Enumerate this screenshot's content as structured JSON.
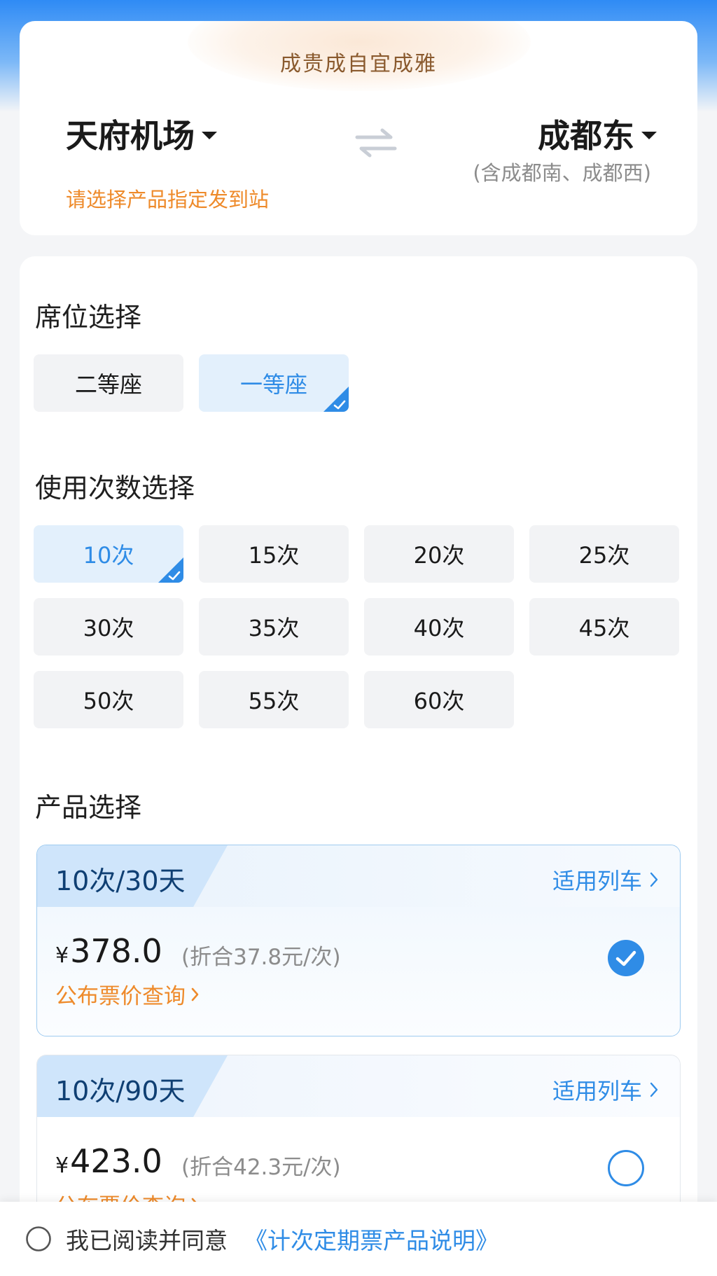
{
  "route": {
    "slogan": "成贵成自宜成雅",
    "from_station": "天府机场",
    "to_station": "成都东",
    "to_sub": "(含成都南、成都西)",
    "station_hint": "请选择产品指定发到站"
  },
  "seat": {
    "title": "席位选择",
    "options": [
      "二等座",
      "一等座"
    ],
    "selected_index": 1
  },
  "usage": {
    "title": "使用次数选择",
    "options": [
      "10次",
      "15次",
      "20次",
      "25次",
      "30次",
      "35次",
      "40次",
      "45次",
      "50次",
      "55次",
      "60次"
    ],
    "selected_index": 0
  },
  "product": {
    "title": "产品选择",
    "items": [
      {
        "tag": "10次/30天",
        "apply_label": "适用列车",
        "currency": "¥",
        "price": "378.0",
        "per_trip": "(折合37.8元/次)",
        "fare_link": "公布票价查询",
        "selected": true
      },
      {
        "tag": "10次/90天",
        "apply_label": "适用列车",
        "currency": "¥",
        "price": "423.0",
        "per_trip": "(折合42.3元/次)",
        "fare_link": "公布票价查询",
        "selected": false
      }
    ]
  },
  "footer": {
    "agree_text": "我已阅读并同意",
    "agree_link": "《计次定期票产品说明》",
    "agreed": false
  },
  "colors": {
    "accent_blue": "#2f8ce6",
    "accent_orange": "#ee8a2a",
    "selected_bg": "#e3f0fc"
  },
  "icons": [
    "swap-icon",
    "dropdown-caret-icon",
    "corner-check-icon",
    "chevron-right-icon",
    "check-circle-icon",
    "radio-empty-icon"
  ]
}
